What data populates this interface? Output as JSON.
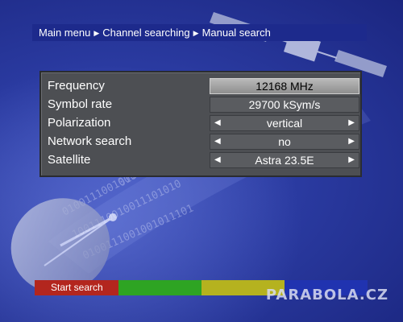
{
  "breadcrumb": {
    "items": [
      "Main menu",
      "Channel searching",
      "Manual search"
    ]
  },
  "settings": [
    {
      "label": "Frequency",
      "value": "12168 MHz",
      "selected": true,
      "arrows": false
    },
    {
      "label": "Symbol rate",
      "value": "29700 kSym/s",
      "selected": false,
      "arrows": false
    },
    {
      "label": "Polarization",
      "value": "vertical",
      "selected": false,
      "arrows": true
    },
    {
      "label": "Network search",
      "value": "no",
      "selected": false,
      "arrows": true
    },
    {
      "label": "Satellite",
      "value": "Astra 23.5E",
      "selected": false,
      "arrows": true
    }
  ],
  "color_buttons": {
    "red": {
      "label": "Start search",
      "color": "#b3261e"
    },
    "green": {
      "label": "",
      "color": "#2ea423"
    },
    "yellow": {
      "label": "",
      "color": "#b5b21f"
    },
    "blue": {
      "label": "",
      "color": "#2033b0"
    }
  },
  "watermark": "PARABOLA.CZ",
  "icons": {
    "breadcrumb_separator": "triangle-right-icon",
    "value_left": "arrow-left-icon",
    "value_right": "arrow-right-icon"
  },
  "colors": {
    "background": "#2a3aa0",
    "breadcrumb_bar": "#1d2a8c",
    "panel": "#4d4f53",
    "selected_field": "#a8a8a8"
  }
}
